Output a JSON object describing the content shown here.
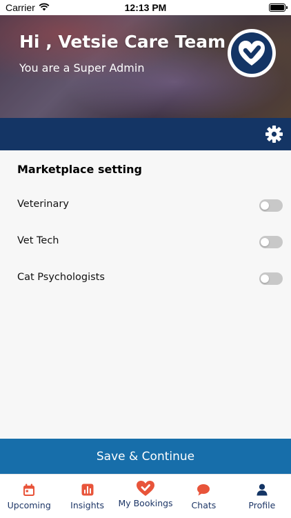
{
  "status_bar": {
    "carrier": "Carrier",
    "time": "12:13 PM"
  },
  "header": {
    "greeting": "Hi , Vetsie Care Team",
    "role": "You are a Super Admin"
  },
  "settings": {
    "section_title": "Marketplace setting",
    "items": [
      {
        "label": "Veterinary",
        "enabled": false
      },
      {
        "label": "Vet Tech",
        "enabled": false
      },
      {
        "label": "Cat Psychologists",
        "enabled": false
      }
    ]
  },
  "actions": {
    "save_label": "Save & Continue"
  },
  "tabbar": {
    "tabs": [
      {
        "label": "Upcoming",
        "icon": "calendar-icon"
      },
      {
        "label": "Insights",
        "icon": "bar-chart-icon"
      },
      {
        "label": "My Bookings",
        "icon": "heart-icon"
      },
      {
        "label": "Chats",
        "icon": "chat-bubble-icon"
      },
      {
        "label": "Profile",
        "icon": "person-icon"
      }
    ]
  },
  "colors": {
    "navy": "#143565",
    "primary_button": "#176eaa",
    "accent_orange": "#e8543a",
    "toggle_off": "#c8c8c8"
  }
}
